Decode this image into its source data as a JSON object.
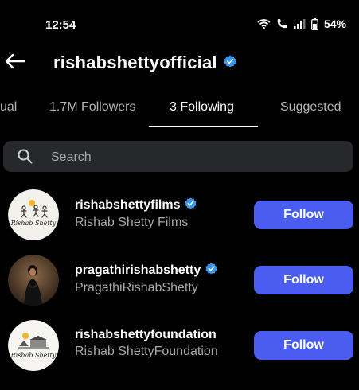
{
  "status_bar": {
    "time": "12:54",
    "battery": "54%",
    "icons": [
      "wifi-icon",
      "call-icon",
      "signal-icon",
      "battery-icon"
    ]
  },
  "header": {
    "title": "rishabshettyofficial",
    "verified": true,
    "back_icon": "back-arrow-icon"
  },
  "tabs": [
    {
      "label": "ual",
      "active": false
    },
    {
      "label": "1.7M Followers",
      "active": false
    },
    {
      "label": "3 Following",
      "active": true
    },
    {
      "label": "Suggested",
      "active": false
    }
  ],
  "search": {
    "placeholder": "Search",
    "value": ""
  },
  "accounts": [
    {
      "username": "rishabshettyfilms",
      "full_name": "Rishab Shetty Films",
      "verified": true,
      "button": "Follow",
      "avatar_text": "Rishab Shetty"
    },
    {
      "username": "pragathirishabshetty",
      "full_name": "PragathiRishabShetty",
      "verified": true,
      "button": "Follow"
    },
    {
      "username": "rishabshettyfoundation",
      "full_name": "Rishab ShettyFoundation",
      "verified": false,
      "button": "Follow",
      "avatar_text": "Rishab Shetty"
    }
  ],
  "colors": {
    "background": "#000000",
    "follow_button": "#4a5df0",
    "verified_badge": "#3897f0",
    "search_bg": "#26282c"
  }
}
